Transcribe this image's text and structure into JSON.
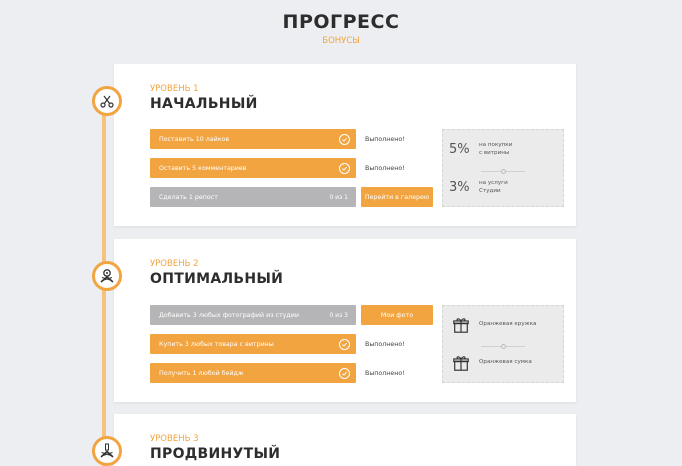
{
  "header": {
    "title": "ПРОГРЕСС",
    "subtitle": "БОНУСЫ"
  },
  "levels": [
    {
      "label": "УРОВЕНЬ 1",
      "name": "НАЧАЛЬНЫЙ",
      "icon": "scissors-comb-icon",
      "tasks": [
        {
          "label": "Поставить 10 лайков",
          "status": "Выполнено!"
        },
        {
          "label": "Оставить 5 комментариев",
          "status": "Выполнено!"
        },
        {
          "label": "Сделать 1 репост",
          "count": "0 из 1",
          "action": "Перейти в галерею"
        }
      ],
      "rewards": [
        {
          "value": "5%",
          "text": "на покупки\nс витрины"
        },
        {
          "value": "3%",
          "text": "на услуги\nСтудии"
        }
      ]
    },
    {
      "label": "УРОВЕНЬ 2",
      "name": "ОПТИМАЛЬНЫЙ",
      "icon": "crossed-tools-icon",
      "tasks": [
        {
          "label": "Добавить 3 любых фотографий из студии",
          "count": "0 из 3",
          "action": "Мои фото"
        },
        {
          "label": "Купить 3 любых товара с витрины",
          "status": "Выполнено!"
        },
        {
          "label": "Получить 1 любой бейдж",
          "status": "Выполнено!"
        }
      ],
      "rewards": [
        {
          "icon": "gift-icon",
          "text": "Оранжевая кружка"
        },
        {
          "icon": "gift-icon",
          "text": "Оранжевая сумка"
        }
      ]
    },
    {
      "label": "УРОВЕНЬ 3",
      "name": "ПРОДВИНУТЫЙ",
      "icon": "crossed-scissors-icon"
    }
  ]
}
